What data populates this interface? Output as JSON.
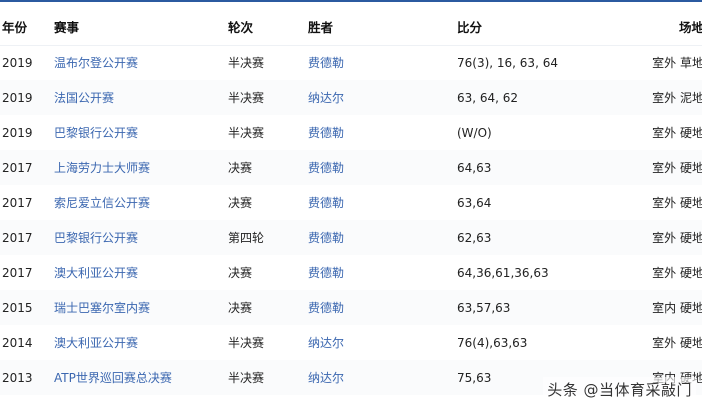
{
  "columns": {
    "year": "年份",
    "event": "赛事",
    "round": "轮次",
    "winner": "胜者",
    "score": "比分",
    "venue": "场地"
  },
  "rows": [
    {
      "year": "2019",
      "event": "温布尔登公开赛",
      "round": "半决赛",
      "winner": "费德勒",
      "score": "76(3), 16, 63, 64",
      "venue": "室外 草地"
    },
    {
      "year": "2019",
      "event": "法国公开赛",
      "round": "半决赛",
      "winner": "纳达尔",
      "score": "63, 64, 62",
      "venue": "室外 泥地"
    },
    {
      "year": "2019",
      "event": "巴黎银行公开赛",
      "round": "半决赛",
      "winner": "费德勒",
      "score": "(W/O)",
      "venue": "室外 硬地"
    },
    {
      "year": "2017",
      "event": "上海劳力士大师赛",
      "round": "决赛",
      "winner": "费德勒",
      "score": "64,63",
      "venue": "室外 硬地"
    },
    {
      "year": "2017",
      "event": "索尼爱立信公开赛",
      "round": "决赛",
      "winner": "费德勒",
      "score": "63,64",
      "venue": "室外 硬地"
    },
    {
      "year": "2017",
      "event": "巴黎银行公开赛",
      "round": "第四轮",
      "winner": "费德勒",
      "score": "62,63",
      "venue": "室外 硬地"
    },
    {
      "year": "2017",
      "event": "澳大利亚公开赛",
      "round": "决赛",
      "winner": "费德勒",
      "score": "64,36,61,36,63",
      "venue": "室外 硬地"
    },
    {
      "year": "2015",
      "event": "瑞士巴塞尔室内赛",
      "round": "决赛",
      "winner": "费德勒",
      "score": "63,57,63",
      "venue": "室内 硬地"
    },
    {
      "year": "2014",
      "event": "澳大利亚公开赛",
      "round": "半决赛",
      "winner": "纳达尔",
      "score": "76(4),63,63",
      "venue": "室外 硬地"
    },
    {
      "year": "2013",
      "event": "ATP世界巡回赛总决赛",
      "round": "半决赛",
      "winner": "纳达尔",
      "score": "75,63",
      "venue": "室内 硬地"
    }
  ],
  "watermark": {
    "text": "头条 @当体育采敲门"
  },
  "colors": {
    "accent_rule": "#2b5aa0",
    "link": "#3b67b0"
  }
}
